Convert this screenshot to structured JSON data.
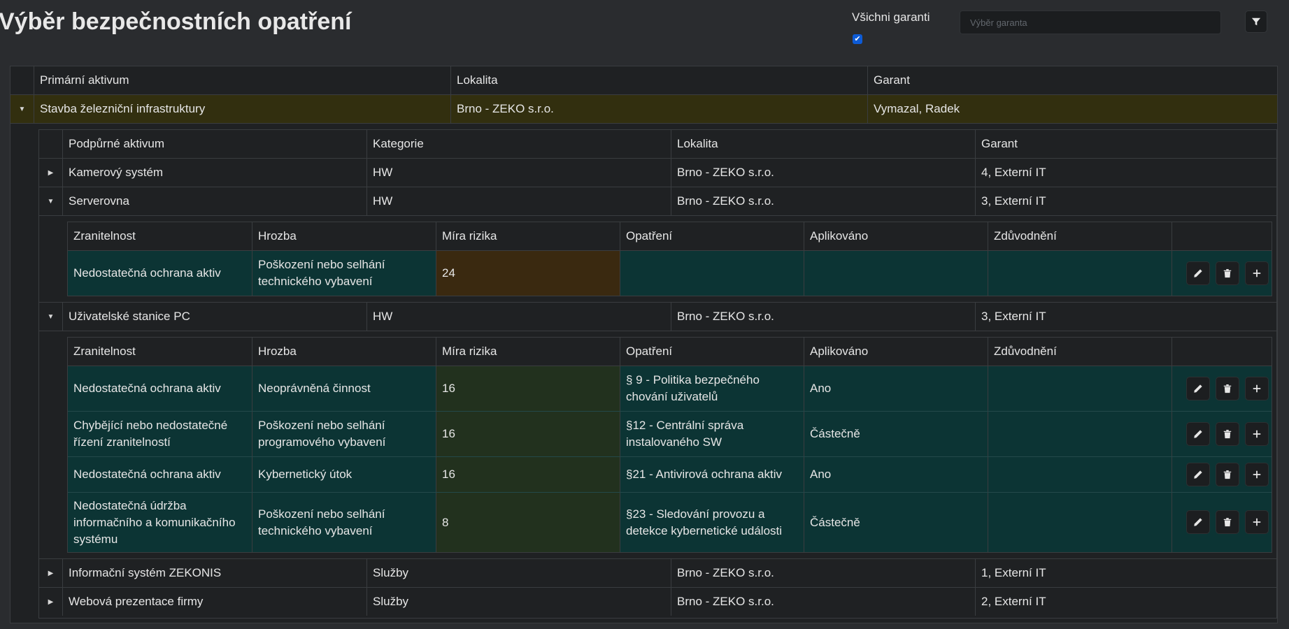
{
  "header": {
    "title": "Výběr bezpečnostních opatření",
    "all_guarantors_label": "Všichni garanti",
    "all_guarantors_checked": true,
    "guarantor_placeholder": "Výběr garanta"
  },
  "primary_table": {
    "columns": [
      "Primární aktivum",
      "Lokalita",
      "Garant"
    ],
    "rows": [
      {
        "asset": "Stavba železniční infrastruktury",
        "location": "Brno - ZEKO s.r.o.",
        "guarantor": "Vymazal, Radek",
        "expanded": true
      }
    ]
  },
  "support_table": {
    "columns": [
      "Podpůrné aktivum",
      "Kategorie",
      "Lokalita",
      "Garant"
    ],
    "rows": [
      {
        "asset": "Kamerový systém",
        "category": "HW",
        "location": "Brno - ZEKO s.r.o.",
        "guarantor": "4, Externí IT",
        "expanded": false
      },
      {
        "asset": "Serverovna",
        "category": "HW",
        "location": "Brno - ZEKO s.r.o.",
        "guarantor": "3, Externí IT",
        "expanded": true
      },
      {
        "asset": "Uživatelské stanice PC",
        "category": "HW",
        "location": "Brno - ZEKO s.r.o.",
        "guarantor": "3, Externí IT",
        "expanded": true
      },
      {
        "asset": "Informační systém ZEKONIS",
        "category": "Služby",
        "location": "Brno - ZEKO s.r.o.",
        "guarantor": "1, Externí IT",
        "expanded": false
      },
      {
        "asset": "Webová prezentace firmy",
        "category": "Služby",
        "location": "Brno - ZEKO s.r.o.",
        "guarantor": "2, Externí IT",
        "expanded": false
      }
    ]
  },
  "risk_columns": [
    "Zranitelnost",
    "Hrozba",
    "Míra rizika",
    "Opatření",
    "Aplikováno",
    "Zdůvodnění"
  ],
  "risk_tables": {
    "serverovna": [
      {
        "vulnerability": "Nedostatečná ochrana aktiv",
        "threat": "Poškození nebo selhání technického vybavení",
        "risk": "24",
        "measure": "",
        "applied": "",
        "justification": ""
      }
    ],
    "stanice": [
      {
        "vulnerability": "Nedostatečná ochrana aktiv",
        "threat": "Neoprávněná činnost",
        "risk": "16",
        "measure": "§ 9 - Politika bezpečného chování uživatelů",
        "applied": "Ano",
        "justification": ""
      },
      {
        "vulnerability": "Chybějící nebo nedostatečné řízení zranitelností",
        "threat": "Poškození nebo selhání programového vybavení",
        "risk": "16",
        "measure": "§12 - Centrální správa instalovaného SW",
        "applied": "Částečně",
        "justification": ""
      },
      {
        "vulnerability": "Nedostatečná ochrana aktiv",
        "threat": "Kybernetický útok",
        "risk": "16",
        "measure": "§21 - Antivirová ochrana aktiv",
        "applied": "Ano",
        "justification": ""
      },
      {
        "vulnerability": "Nedostatečná údržba informačního a komunikačního systému",
        "threat": "Poškození nebo selhání technického vybavení",
        "risk": "8",
        "measure": "§23 - Sledování provozu a detekce kybernetické události",
        "applied": "Částečně",
        "justification": ""
      }
    ]
  },
  "icons": {
    "expanded": "caret-down-icon",
    "collapsed": "caret-right-icon",
    "edit": "pencil-icon",
    "delete": "trash-icon",
    "add": "plus-icon",
    "filter": "filter-icon"
  },
  "colors": {
    "background": "#2a2c2f",
    "table_bg": "#1f2123",
    "primary_row_highlight": "#322f0f",
    "risk_row_teal": "#0c3434",
    "risk_cell_high": "#3a2910",
    "risk_cell_medium": "#22311e",
    "checkbox_accent": "#0d5bd6"
  }
}
